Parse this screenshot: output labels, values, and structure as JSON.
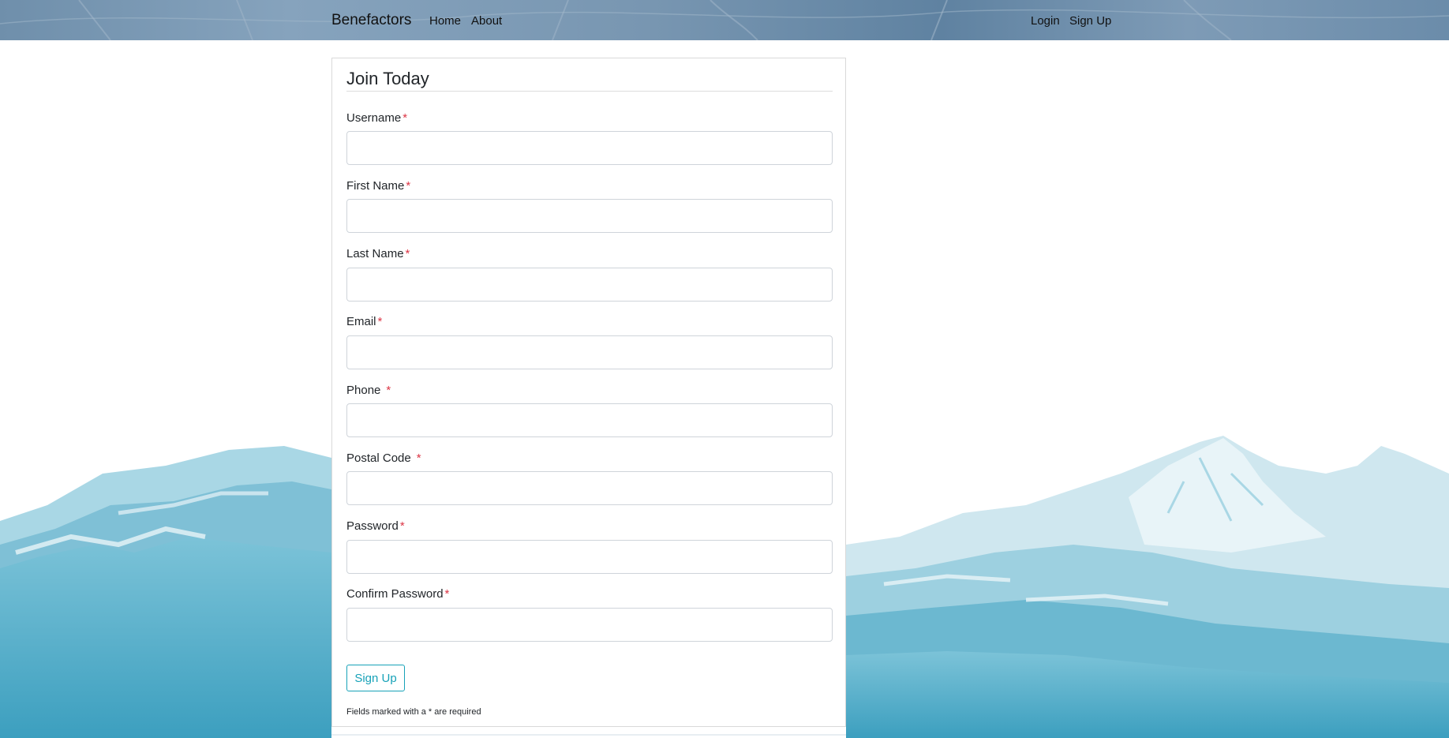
{
  "nav": {
    "brand": "Benefactors",
    "home": "Home",
    "about": "About",
    "login": "Login",
    "signup": "Sign Up"
  },
  "form": {
    "title": "Join Today",
    "fields": [
      {
        "label": "Username",
        "value": "",
        "required_mark": "*"
      },
      {
        "label": "First Name",
        "value": "",
        "required_mark": "*"
      },
      {
        "label": "Last Name",
        "value": "",
        "required_mark": "*"
      },
      {
        "label": "Email",
        "value": "",
        "required_mark": "*"
      },
      {
        "label": "Phone",
        "value": "",
        "required_mark": "*"
      },
      {
        "label": "Postal Code",
        "value": "",
        "required_mark": "*"
      },
      {
        "label": "Password",
        "value": "",
        "required_mark": "*"
      },
      {
        "label": "Confirm Password",
        "value": "",
        "required_mark": "*"
      }
    ],
    "submit_label": "Sign Up",
    "footnote": "Fields marked with a * are required"
  },
  "colors": {
    "accent": "#17a2b8",
    "required": "#dc3545",
    "navbar": "#7896b1",
    "water": "#4aa9c5",
    "snow": "#e8f4f8"
  },
  "icons": {
    "background": "snowy-mountains-illustration"
  }
}
